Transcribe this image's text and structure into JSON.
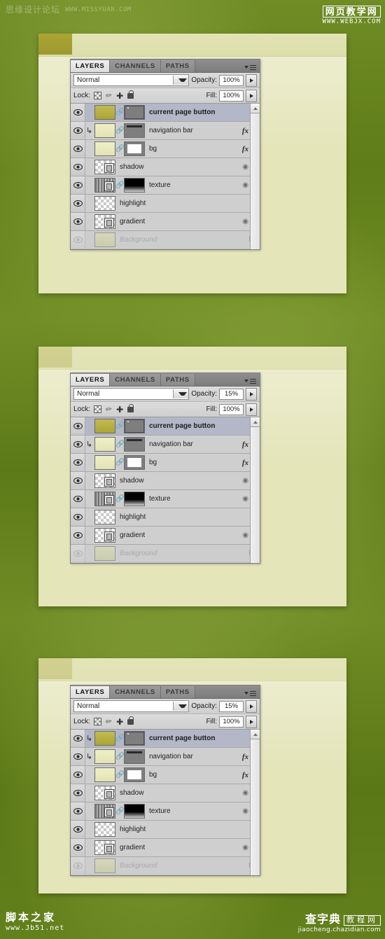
{
  "watermarks": {
    "top_left_cn": "思缘设计论坛",
    "top_left_url": "WWW.MISSYUAN.COM",
    "top_right_cn": "网页教学网",
    "top_right_url": "WWW.WEBJX.COM",
    "bottom_left_cn": "脚本之家",
    "bottom_left_url": "www.Jb51.net",
    "bottom_right_cn": "查字典",
    "bottom_right_box": "教程网",
    "bottom_right_url": "jiaocheng.chazidian.com"
  },
  "colors": {
    "background_green": "#5d7a19",
    "mockup_cream": "#e4e5b9",
    "current_tab_olive": "#aba533",
    "selected_row": "#b4b7c8",
    "palette_grey": "#d2d2d2"
  },
  "palette": {
    "tabs": [
      {
        "label": "LAYERS",
        "active": true
      },
      {
        "label": "CHANNELS",
        "active": false
      },
      {
        "label": "PATHS",
        "active": false
      }
    ],
    "menu_icon": "panel-menu-icon",
    "blend_mode": "Normal",
    "opacity_label": "Opacity:",
    "fill_label": "Fill:",
    "lock_label": "Lock:",
    "lock_icons": [
      "lock-transparent-pixels-icon",
      "lock-image-pixels-icon",
      "lock-position-icon",
      "lock-all-icon"
    ]
  },
  "panels": [
    {
      "id": "panel-1",
      "opacity": "100%",
      "fill": "100%",
      "navbar_faded": false,
      "layers": [
        {
          "name": "current page button",
          "selected": true,
          "bold": true,
          "clipped": false,
          "thumb": "solid-olive",
          "has_mask": true,
          "mask": "grey-rect-dot",
          "linked": true,
          "fx": false,
          "mask_indicator": false,
          "caret": false,
          "locked": false,
          "dim": false
        },
        {
          "name": "navigation bar",
          "selected": false,
          "bold": false,
          "clipped": true,
          "thumb": "solid-cream",
          "has_mask": true,
          "mask": "grey-bar",
          "linked": true,
          "fx": true,
          "mask_indicator": false,
          "caret": true,
          "locked": false,
          "dim": false
        },
        {
          "name": "bg",
          "selected": false,
          "bold": false,
          "clipped": false,
          "thumb": "solid-cream",
          "has_mask": true,
          "mask": "grey-white-box",
          "linked": true,
          "fx": true,
          "mask_indicator": false,
          "caret": true,
          "locked": false,
          "dim": false
        },
        {
          "name": "shadow",
          "selected": false,
          "bold": false,
          "clipped": false,
          "thumb": "checker-fx",
          "has_mask": false,
          "mask": "",
          "linked": false,
          "fx": false,
          "mask_indicator": true,
          "caret": true,
          "locked": false,
          "dim": false
        },
        {
          "name": "texture",
          "selected": false,
          "bold": false,
          "clipped": false,
          "thumb": "texture-fx",
          "has_mask": true,
          "mask": "black-gradient",
          "linked": true,
          "fx": false,
          "mask_indicator": true,
          "caret": true,
          "locked": false,
          "dim": false
        },
        {
          "name": "highlight",
          "selected": false,
          "bold": false,
          "clipped": false,
          "thumb": "checker",
          "has_mask": false,
          "mask": "",
          "linked": false,
          "fx": false,
          "mask_indicator": false,
          "caret": false,
          "locked": false,
          "dim": false
        },
        {
          "name": "gradient",
          "selected": false,
          "bold": false,
          "clipped": false,
          "thumb": "checker-fx",
          "has_mask": false,
          "mask": "",
          "linked": false,
          "fx": false,
          "mask_indicator": true,
          "caret": true,
          "locked": false,
          "dim": false
        },
        {
          "name": "Background",
          "selected": false,
          "bold": false,
          "clipped": false,
          "thumb": "solid-bggreen",
          "has_mask": false,
          "mask": "",
          "linked": false,
          "fx": false,
          "mask_indicator": false,
          "caret": false,
          "locked": true,
          "dim": true
        }
      ]
    },
    {
      "id": "panel-2",
      "opacity": "15%",
      "fill": "100%",
      "navbar_faded": true,
      "layers": [
        {
          "name": "current page button",
          "selected": true,
          "bold": true,
          "clipped": false,
          "thumb": "solid-olive",
          "has_mask": true,
          "mask": "grey-rect-dot",
          "linked": true,
          "fx": false,
          "mask_indicator": false,
          "caret": false,
          "locked": false,
          "dim": false
        },
        {
          "name": "navigation bar",
          "selected": false,
          "bold": false,
          "clipped": true,
          "thumb": "solid-cream",
          "has_mask": true,
          "mask": "grey-bar",
          "linked": true,
          "fx": true,
          "mask_indicator": false,
          "caret": true,
          "locked": false,
          "dim": false
        },
        {
          "name": "bg",
          "selected": false,
          "bold": false,
          "clipped": false,
          "thumb": "solid-cream",
          "has_mask": true,
          "mask": "grey-white-box",
          "linked": true,
          "fx": true,
          "mask_indicator": false,
          "caret": true,
          "locked": false,
          "dim": false
        },
        {
          "name": "shadow",
          "selected": false,
          "bold": false,
          "clipped": false,
          "thumb": "checker-fx",
          "has_mask": false,
          "mask": "",
          "linked": false,
          "fx": false,
          "mask_indicator": true,
          "caret": true,
          "locked": false,
          "dim": false
        },
        {
          "name": "texture",
          "selected": false,
          "bold": false,
          "clipped": false,
          "thumb": "texture-fx",
          "has_mask": true,
          "mask": "black-gradient",
          "linked": true,
          "fx": false,
          "mask_indicator": true,
          "caret": true,
          "locked": false,
          "dim": false
        },
        {
          "name": "highlight",
          "selected": false,
          "bold": false,
          "clipped": false,
          "thumb": "checker",
          "has_mask": false,
          "mask": "",
          "linked": false,
          "fx": false,
          "mask_indicator": false,
          "caret": false,
          "locked": false,
          "dim": false
        },
        {
          "name": "gradient",
          "selected": false,
          "bold": false,
          "clipped": false,
          "thumb": "checker-fx",
          "has_mask": false,
          "mask": "",
          "linked": false,
          "fx": false,
          "mask_indicator": true,
          "caret": true,
          "locked": false,
          "dim": false
        },
        {
          "name": "Background",
          "selected": false,
          "bold": false,
          "clipped": false,
          "thumb": "solid-bggreen",
          "has_mask": false,
          "mask": "",
          "linked": false,
          "fx": false,
          "mask_indicator": false,
          "caret": false,
          "locked": true,
          "dim": true
        }
      ]
    },
    {
      "id": "panel-3",
      "opacity": "15%",
      "fill": "100%",
      "navbar_faded": true,
      "layers": [
        {
          "name": "current page button",
          "selected": true,
          "bold": true,
          "clipped": true,
          "thumb": "solid-olive",
          "has_mask": true,
          "mask": "grey-rect-dot",
          "linked": true,
          "fx": false,
          "mask_indicator": false,
          "caret": false,
          "locked": false,
          "dim": false
        },
        {
          "name": "navigation bar",
          "selected": false,
          "bold": false,
          "clipped": true,
          "thumb": "solid-cream",
          "has_mask": true,
          "mask": "grey-bar",
          "linked": true,
          "fx": true,
          "mask_indicator": false,
          "caret": true,
          "locked": false,
          "dim": false
        },
        {
          "name": "bg",
          "selected": false,
          "bold": false,
          "clipped": false,
          "thumb": "solid-cream",
          "has_mask": true,
          "mask": "grey-white-box",
          "linked": true,
          "fx": true,
          "mask_indicator": false,
          "caret": true,
          "locked": false,
          "dim": false
        },
        {
          "name": "shadow",
          "selected": false,
          "bold": false,
          "clipped": false,
          "thumb": "checker-fx",
          "has_mask": false,
          "mask": "",
          "linked": false,
          "fx": false,
          "mask_indicator": true,
          "caret": true,
          "locked": false,
          "dim": false
        },
        {
          "name": "texture",
          "selected": false,
          "bold": false,
          "clipped": false,
          "thumb": "texture-fx",
          "has_mask": true,
          "mask": "black-gradient",
          "linked": true,
          "fx": false,
          "mask_indicator": true,
          "caret": true,
          "locked": false,
          "dim": false
        },
        {
          "name": "highlight",
          "selected": false,
          "bold": false,
          "clipped": false,
          "thumb": "checker",
          "has_mask": false,
          "mask": "",
          "linked": false,
          "fx": false,
          "mask_indicator": false,
          "caret": false,
          "locked": false,
          "dim": false
        },
        {
          "name": "gradient",
          "selected": false,
          "bold": false,
          "clipped": false,
          "thumb": "checker-fx",
          "has_mask": false,
          "mask": "",
          "linked": false,
          "fx": false,
          "mask_indicator": true,
          "caret": true,
          "locked": false,
          "dim": false
        },
        {
          "name": "Background",
          "selected": false,
          "bold": false,
          "clipped": false,
          "thumb": "solid-bggreen",
          "has_mask": false,
          "mask": "",
          "linked": false,
          "fx": false,
          "mask_indicator": false,
          "caret": false,
          "locked": true,
          "dim": true
        }
      ]
    }
  ]
}
